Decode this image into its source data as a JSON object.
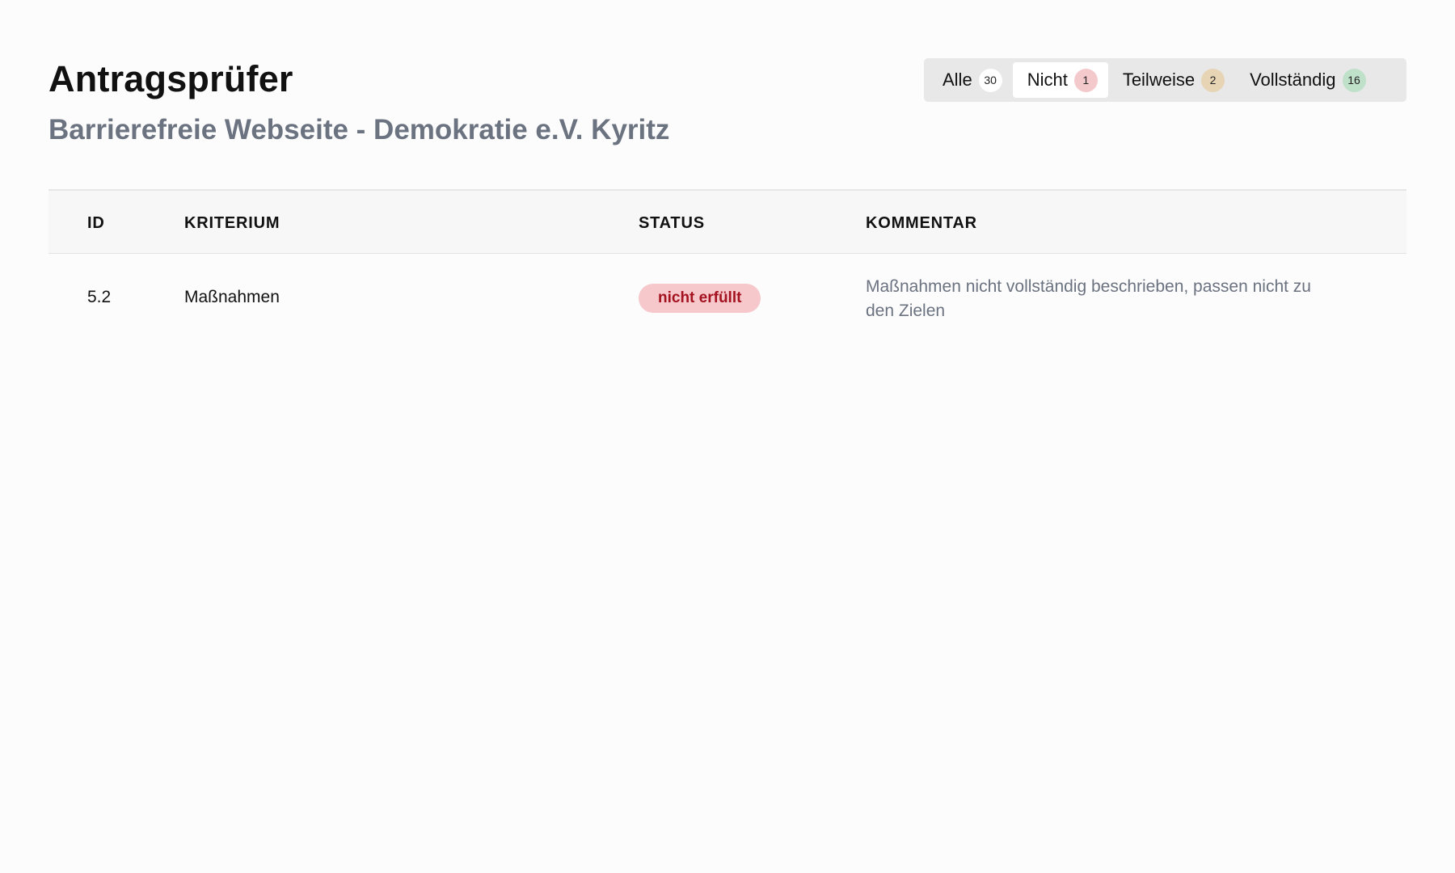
{
  "header": {
    "title": "Antragsprüfer",
    "subtitle": "Barrierefreie Webseite - Demokratie e.V. Kyritz"
  },
  "filters": {
    "active": "Nicht",
    "items": [
      {
        "label": "Alle",
        "count": "30",
        "color": "#ffffff"
      },
      {
        "label": "Nicht",
        "count": "1",
        "color": "#f4c9cc"
      },
      {
        "label": "Teilweise",
        "count": "2",
        "color": "#e6d4b5"
      },
      {
        "label": "Vollständig",
        "count": "16",
        "color": "#bfe0c9"
      }
    ]
  },
  "table": {
    "columns": {
      "id": "ID",
      "kriterium": "KRITERIUM",
      "status": "STATUS",
      "kommentar": "KOMMENTAR"
    },
    "rows": [
      {
        "id": "5.2",
        "kriterium": "Maßnahmen",
        "status": "nicht erfüllt",
        "status_color": "#a3121e",
        "status_bg": "#f6c8cc",
        "kommentar": "Maßnahmen nicht vollständig beschrieben, passen nicht zu den Zielen"
      }
    ]
  }
}
